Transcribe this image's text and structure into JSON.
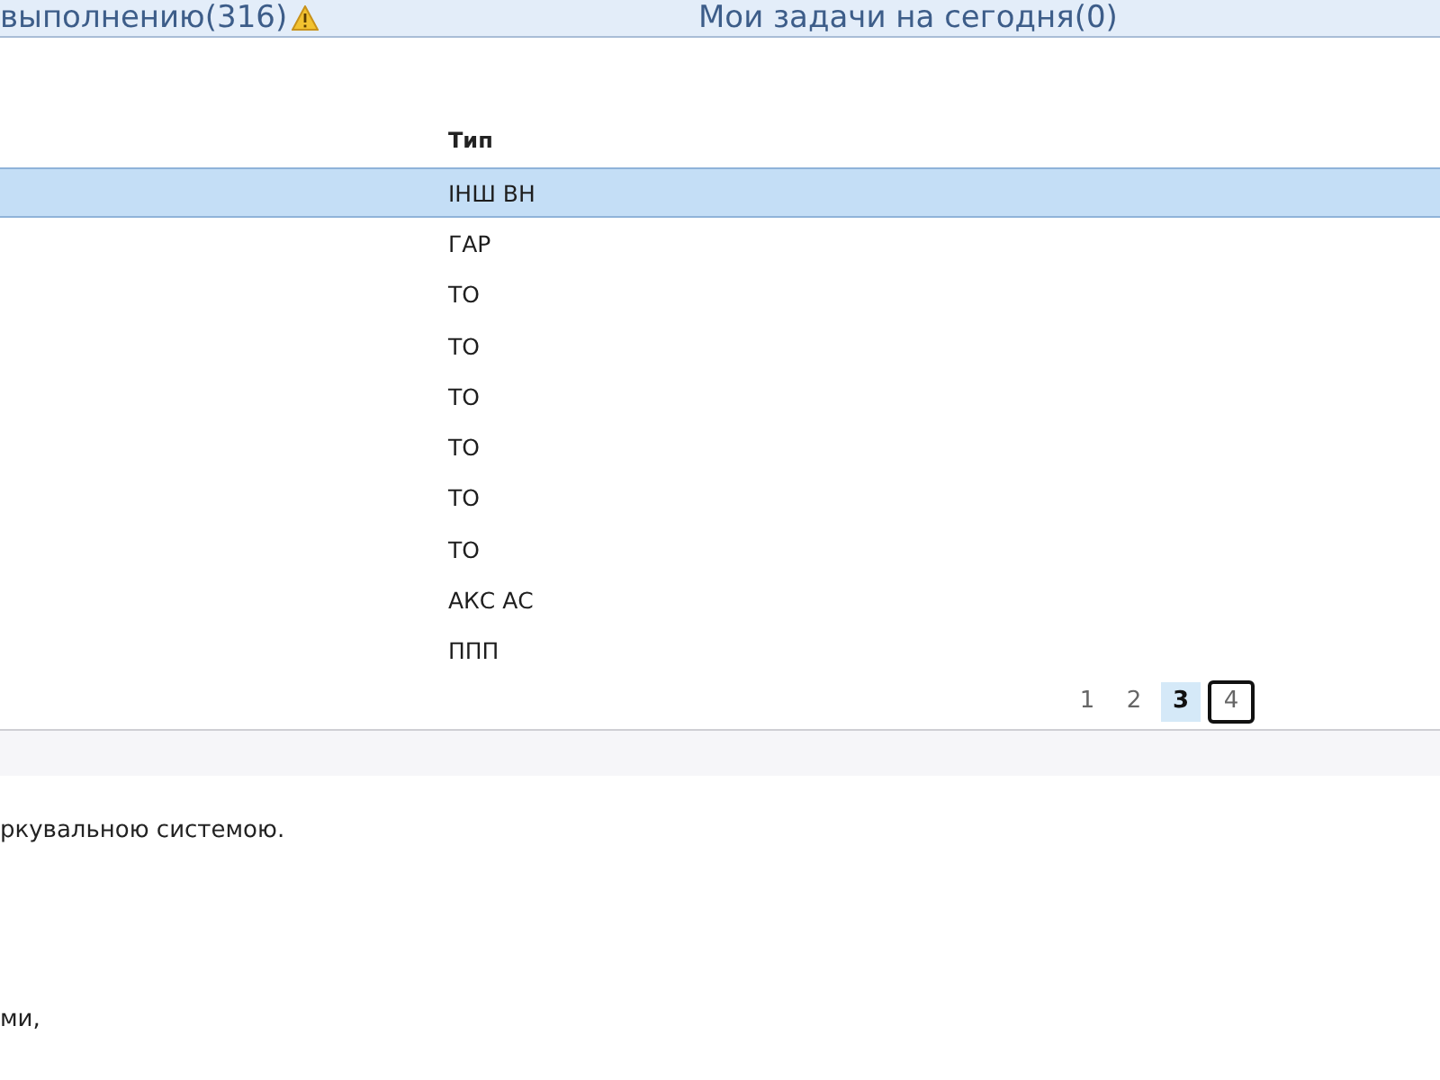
{
  "header_tabs": [
    {
      "label": "выполнению(316)",
      "warning": true
    },
    {
      "label": "Мои задачи на сегодня(0)",
      "warning": false
    }
  ],
  "table": {
    "columns": [
      "Тип"
    ],
    "rows": [
      {
        "type": "ІНШ ВН",
        "selected": true
      },
      {
        "type": "ГАР",
        "selected": false
      },
      {
        "type": "ТО",
        "selected": false
      },
      {
        "type": "ТО",
        "selected": false
      },
      {
        "type": "ТО",
        "selected": false
      },
      {
        "type": "ТО",
        "selected": false
      },
      {
        "type": "ТО",
        "selected": false
      },
      {
        "type": "ТО",
        "selected": false
      },
      {
        "type": "АКС АС",
        "selected": false
      },
      {
        "type": "ППП",
        "selected": false
      }
    ]
  },
  "pagination": [
    {
      "label": "1",
      "selected": false,
      "focused": false
    },
    {
      "label": "2",
      "selected": false,
      "focused": false
    },
    {
      "label": "3",
      "selected": true,
      "focused": false
    },
    {
      "label": "4",
      "selected": false,
      "focused": true
    }
  ],
  "details": {
    "lines": [
      "ркувальною системою.",
      "ми,"
    ]
  }
}
